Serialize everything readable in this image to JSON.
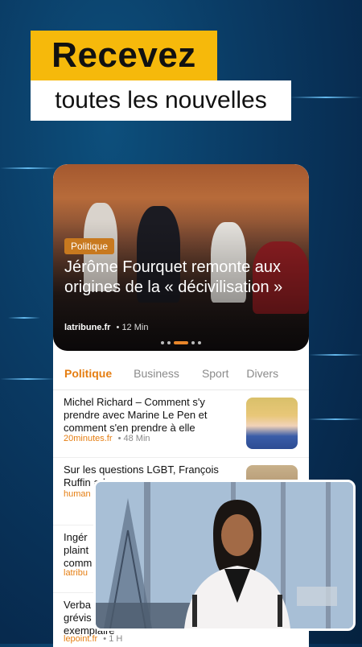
{
  "promo": {
    "headline": "Recevez",
    "subheadline": "toutes les nouvelles"
  },
  "hero": {
    "category": "Politique",
    "title": "Jérôme Fourquet remonte aux origines de la « décivilisation »",
    "source": "latribune.fr",
    "time": "12 Min",
    "dots": 5,
    "active_dot": 2
  },
  "tabs": [
    {
      "label": "Politique",
      "active": true
    },
    {
      "label": "Business",
      "active": false
    },
    {
      "label": "Sport",
      "active": false
    },
    {
      "label": "Divers",
      "active": false
    }
  ],
  "articles": [
    {
      "title": "Michel Richard – Comment s'y prendre avec Marine Le Pen et comment s'en prendre à elle",
      "source": "20minutes.fr",
      "time": "48 Min"
    },
    {
      "title": "Sur les questions LGBT, François Ruffin ad",
      "source": "human"
    },
    {
      "title": "Ingér plaint comm",
      "source": "latribu"
    },
    {
      "title": "Verba grévis exemplaire",
      "source": "lepoint.fr",
      "time": "1 H"
    }
  ],
  "colors": {
    "accent_orange": "#e57e12",
    "promo_yellow": "#f6b90b",
    "background_blue": "#0a3a63"
  }
}
